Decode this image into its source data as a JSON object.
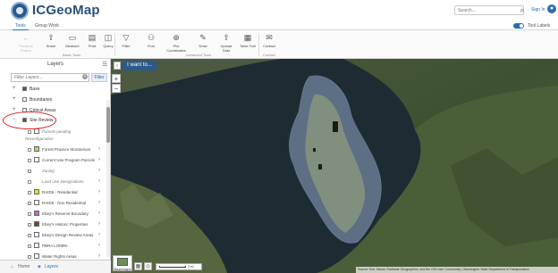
{
  "app": {
    "title": "ICGeoMap",
    "search_placeholder": "Search...",
    "sign_in": "Sign In"
  },
  "tabs": [
    {
      "label": "Tools",
      "active": true
    },
    {
      "label": "Group Work",
      "active": false
    }
  ],
  "tool_labels_toggle": {
    "label": "Tool Labels",
    "on": true
  },
  "ribbon": {
    "tools": [
      {
        "label": "Previous Extent",
        "icon": "back-arrow-icon",
        "disabled": true
      },
      {
        "label": "Next Extent",
        "icon": "forward-arrow-icon",
        "disabled": true
      },
      {
        "label": "Share",
        "icon": "share-icon",
        "disabled": false
      },
      {
        "label": "Measure",
        "icon": "ruler-icon",
        "disabled": false
      },
      {
        "label": "Print",
        "icon": "printer-icon",
        "disabled": false
      },
      {
        "label": "Query",
        "icon": "query-icon",
        "disabled": false
      },
      {
        "label": "Filter",
        "icon": "funnel-icon",
        "disabled": false
      },
      {
        "label": "Find",
        "icon": "binoculars-icon",
        "disabled": false
      },
      {
        "label": "Plot Coordinates",
        "icon": "crosshair-icon",
        "disabled": false
      },
      {
        "label": "Draw",
        "icon": "pencil-icon",
        "disabled": false
      },
      {
        "label": "Upload Data",
        "icon": "upload-icon",
        "disabled": false
      },
      {
        "label": "Table Tool",
        "icon": "table-icon",
        "disabled": false
      },
      {
        "label": "Contact",
        "icon": "envelope-icon",
        "disabled": false
      }
    ],
    "groups": [
      "Basic Tools",
      "Advanced Tools",
      "Contact"
    ]
  },
  "layers_panel": {
    "title": "Layers",
    "filter_placeholder": "Filter Layers...",
    "filter_button": "Filter",
    "layers": [
      {
        "label": "Base",
        "expander": "+",
        "checked": true
      },
      {
        "label": "Boundaries",
        "expander": "+",
        "checked": false
      },
      {
        "label": "Critical Areas",
        "expander": "+",
        "checked": false
      },
      {
        "label": "Site Review",
        "expander": "−",
        "checked": true
      }
    ],
    "sub_layers": [
      {
        "label": "Parcels pending",
        "swatch": "#ffffff",
        "italic": true
      },
      {
        "label": "Reconfiguration",
        "swatch": "",
        "italic": true
      },
      {
        "label": "Forest Practice Moratorium",
        "swatch": "#a8d878",
        "italic": false
      },
      {
        "label": "Current Use Program Parcels",
        "swatch": "#ffffff",
        "italic": false
      },
      {
        "label": "Zoning",
        "swatch": "",
        "italic": true
      },
      {
        "label": "Land Use Designations",
        "swatch": "",
        "italic": true
      },
      {
        "label": "RAID5 - Residential",
        "swatch": "#e8e020",
        "italic": false
      },
      {
        "label": "RAID5 - Non Residential",
        "swatch": "#ffffff",
        "italic": false
      },
      {
        "label": "Ebey's Reserve Boundary",
        "swatch": "#b070c8",
        "italic": false
      },
      {
        "label": "Ebey's Historic Properties",
        "swatch": "#6b4a2a",
        "italic": false
      },
      {
        "label": "Ebey's Design Review Areas",
        "swatch": "#ffffff",
        "italic": false
      },
      {
        "label": "PBRA LOMRs",
        "swatch": "#ffffff",
        "italic": false
      },
      {
        "label": "Water Rights Areas",
        "swatch": "#ffffff",
        "italic": false
      }
    ]
  },
  "bottom_tabs": [
    {
      "label": "Home",
      "active": false
    },
    {
      "label": "Layers",
      "active": true
    }
  ],
  "map": {
    "i_want_to": "I want to...",
    "zoom_in": "+",
    "zoom_out": "−",
    "basemaps_label": "Basemaps",
    "scale_label": "2 mi",
    "attribution": "Source: Esri, Maxar, Earthstar Geographics, and the GIS User Community | Washington State Department of Transportation"
  }
}
